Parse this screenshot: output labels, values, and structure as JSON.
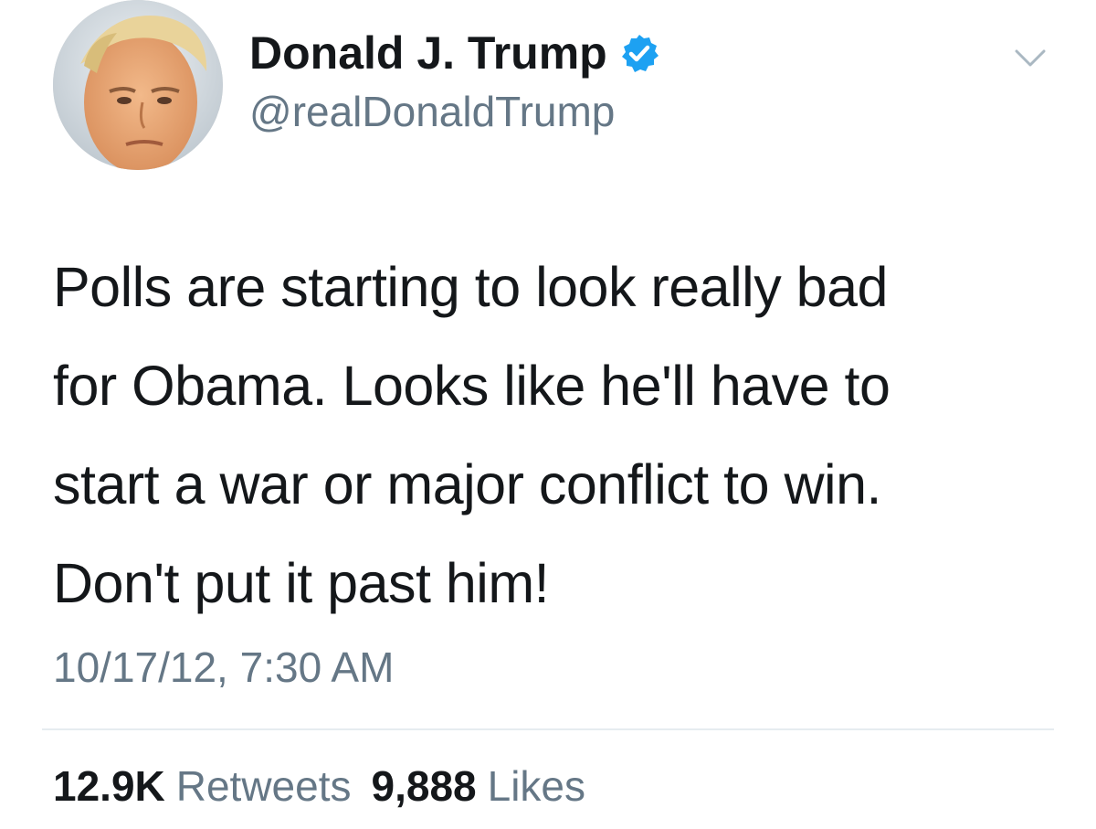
{
  "header": {
    "display_name": "Donald J. Trump",
    "handle": "@realDonaldTrump",
    "verified_icon": "verified-badge-icon",
    "menu_icon": "chevron-down-icon",
    "avatar_icon": "profile-photo"
  },
  "tweet": {
    "lines": [
      "Polls are starting to look really bad",
      "for Obama. Looks like he'll have to",
      "start a war or major conflict to win.",
      "Don't put it past him!"
    ],
    "timestamp": "10/17/12, 7:30 AM"
  },
  "stats": {
    "retweets_count": "12.9K",
    "retweets_label": "Retweets",
    "likes_count": "9,888",
    "likes_label": "Likes"
  },
  "colors": {
    "text": "#14171a",
    "secondary": "#657786",
    "verified": "#1da1f2",
    "divider": "#e6ecf0"
  }
}
